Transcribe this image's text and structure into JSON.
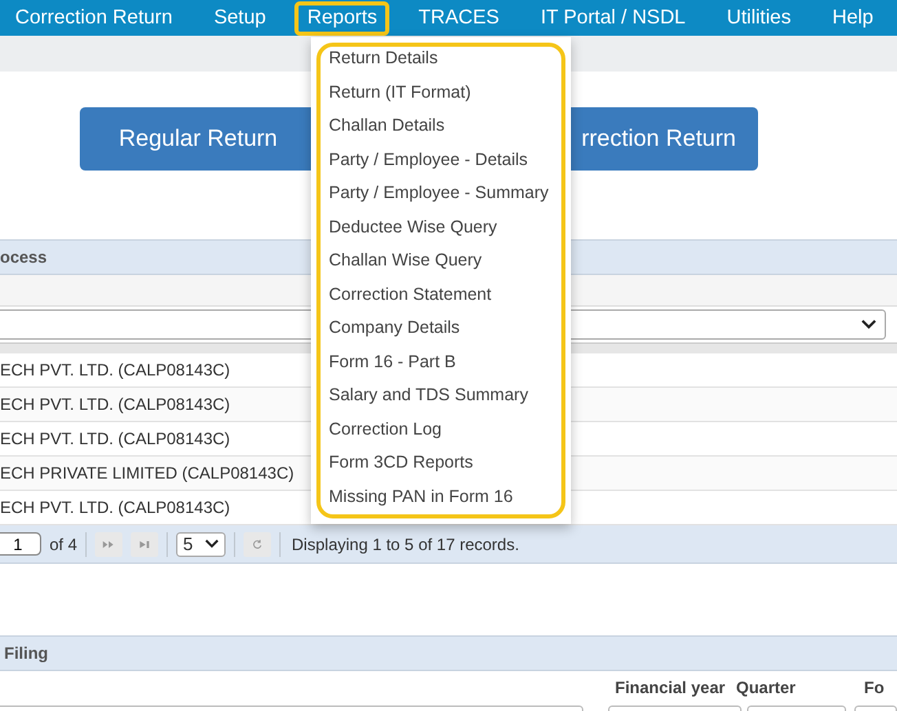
{
  "menu_bar": [
    {
      "label": "Correction Return",
      "selected": false
    },
    {
      "label": "Setup",
      "selected": false
    },
    {
      "label": "Reports",
      "selected": true
    },
    {
      "label": "TRACES",
      "selected": false
    },
    {
      "label": "IT Portal / NSDL",
      "selected": false
    },
    {
      "label": "Utilities",
      "selected": false
    },
    {
      "label": "Help",
      "selected": false
    }
  ],
  "reports_menu": [
    "Return Details",
    "Return (IT Format)",
    "Challan Details",
    "Party / Employee - Details",
    "Party / Employee - Summary",
    "Deductee Wise Query",
    "Challan Wise Query",
    "Correction Statement",
    "Company Details",
    "Form 16 - Part B",
    "Salary and TDS Summary",
    "Correction Log",
    "Form 3CD Reports",
    "Missing PAN in Form 16"
  ],
  "return_buttons": [
    "Regular Return",
    "rrection Return"
  ],
  "process_panel": {
    "title": "ocess",
    "rows": [
      "ECH PVT. LTD. (CALP08143C)",
      "ECH PVT. LTD. (CALP08143C)",
      "ECH PVT. LTD. (CALP08143C)",
      "ECH PRIVATE LIMITED (CALP08143C)",
      "ECH PVT. LTD. (CALP08143C)"
    ],
    "pager": {
      "page": "1",
      "of": "of 4",
      "page_size": "5",
      "status": "Displaying 1 to 5 of 17 records."
    }
  },
  "filing_panel": {
    "title": "Filing",
    "columns": [
      "Financial year",
      "Quarter",
      "Fo"
    ]
  }
}
